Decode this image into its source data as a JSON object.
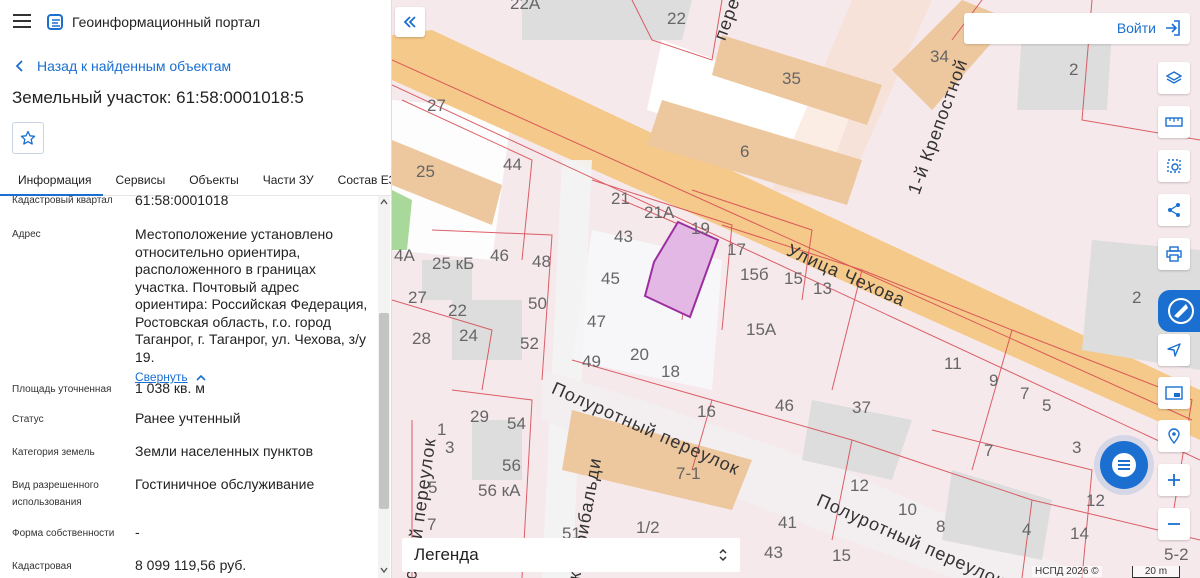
{
  "header": {
    "app_title": "Геоинформационный портал"
  },
  "nav": {
    "back_label": "Назад к найденным объектам"
  },
  "object": {
    "title": "Земельный участок: 61:58:0001018:5"
  },
  "tabs": [
    {
      "label": "Информация",
      "active": true
    },
    {
      "label": "Сервисы"
    },
    {
      "label": "Объекты"
    },
    {
      "label": "Части ЗУ"
    },
    {
      "label": "Состав ЕЗП"
    }
  ],
  "info": {
    "quarter_label": "Кадастровый квартал",
    "quarter_value": "61:58:0001018",
    "address_label": "Адрес",
    "address_value": "Местоположение установлено относительно ориентира, расположенного в границах участка. Почтовый адрес ориентира: Российская Федерация, Ростовская область, г.о. город Таганрог, г. Таганрог, ул. Чехова, з/у 19.",
    "collapse_label": "Свернуть",
    "area_label": "Площадь уточненная",
    "area_value": "1 038 кв. м",
    "status_label": "Статус",
    "status_value": "Ранее учтенный",
    "category_label": "Категория земель",
    "category_value": "Земли населенных пунктов",
    "usage_label": "Вид разрешенного использования",
    "usage_value": "Гостиничное обслуживание",
    "ownership_label": "Форма собственности",
    "ownership_value": "-",
    "cadastral_cost_label": "Кадастровая",
    "cadastral_cost_value": "8 099 119,56 руб."
  },
  "map": {
    "login_label": "Войти",
    "legend_label": "Легенда",
    "attribution": "НСПД 2026 ©",
    "scale_label": "20 m",
    "streets": {
      "chekhova": "Улица Чехова",
      "polurotny1": "Полуротный переулок",
      "polurotny2": "Полуротный переулок",
      "krepostnoy": "1-й Крепостной",
      "garibaldi": "к Гарибальди",
      "pereulok_left": "стной переулок",
      "pere_top": "пере"
    },
    "numbers": {
      "n22a": "22А",
      "n22": "22",
      "n35": "35",
      "n34": "34",
      "n2a": "2",
      "n27": "27",
      "n6": "6",
      "n25": "25",
      "n44": "44",
      "n21": "21",
      "n21a": "21А",
      "n19": "19",
      "n17": "17",
      "n43": "43",
      "n25kb": "25 кБ",
      "n46": "46",
      "n48": "48",
      "n45": "45",
      "n15b": "15б",
      "n15": "15",
      "n13": "13",
      "n2b": "2",
      "n27b": "27",
      "n22b": "22",
      "n50": "50",
      "n47": "47",
      "n28": "28",
      "n24": "24",
      "n52": "52",
      "n49": "49",
      "n20": "20",
      "n15a": "15А",
      "n18": "18",
      "n11": "11",
      "n9": "9",
      "n7a": "7",
      "n5": "5",
      "n16": "16",
      "n46b": "46",
      "n37": "37",
      "n1": "1",
      "n3": "3",
      "n29": "29",
      "n54": "54",
      "n56": "56",
      "n56ka": "56 кА",
      "n5b": "5",
      "n7b": "7",
      "n71": "7-1",
      "n12": "12",
      "n7c": "7",
      "n3b": "3",
      "n12b": "12",
      "n10": "10",
      "n51": "51",
      "n12slash": "1/2",
      "n41": "41",
      "n8": "8",
      "n4": "4",
      "n14": "14",
      "n43b": "43",
      "n15c": "15",
      "n52b": "5-2",
      "n4a": "4А"
    }
  },
  "colors": {
    "accent": "#1a6fd1",
    "selected_parcel": "#e3b8e4",
    "road": "#f5c98a",
    "building": "#edc79d"
  }
}
